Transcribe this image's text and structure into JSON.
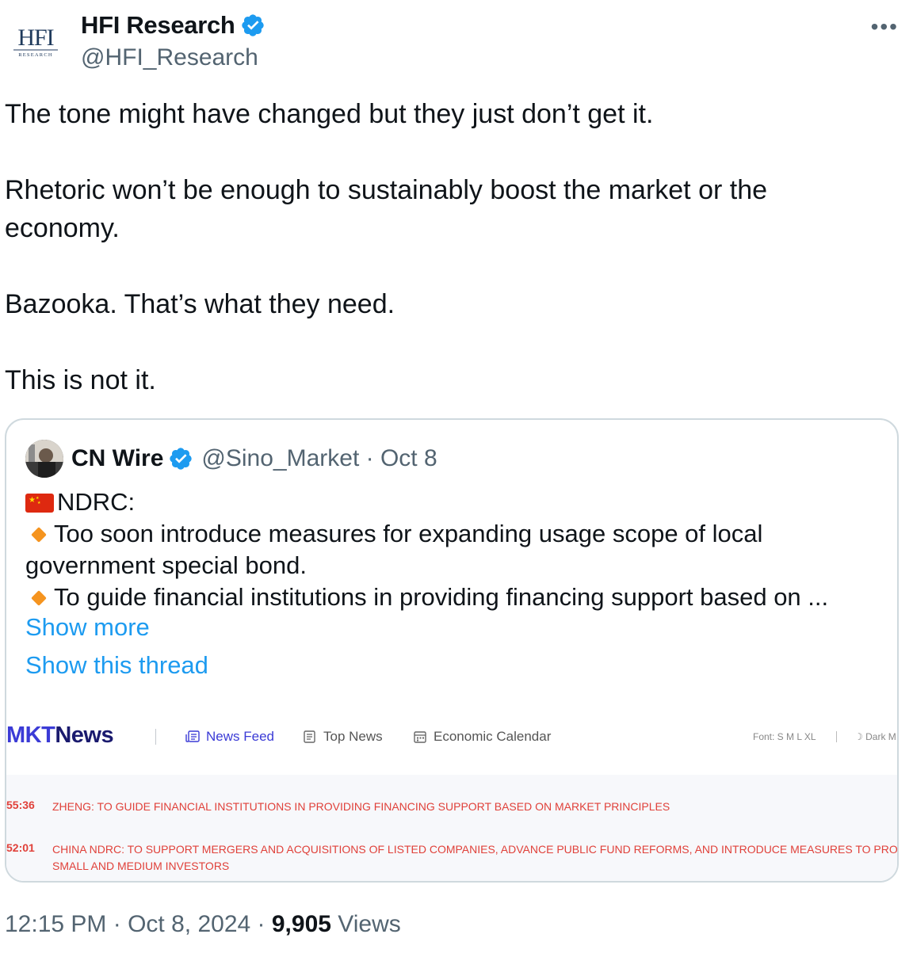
{
  "author": {
    "name": "HFI Research",
    "handle": "@HFI_Research",
    "avatar_text": "HFI",
    "avatar_subtext": "RESEARCH",
    "verified_color": "#1d9bf0"
  },
  "tweet": {
    "paragraphs": [
      "The tone might have changed but they just don’t get it.",
      "Rhetoric won’t be enough to sustainably boost the market or the economy.",
      "Bazooka. That’s what they need.",
      "This is not it."
    ]
  },
  "quote": {
    "name": "CN Wire",
    "handle": "@Sino_Market",
    "date": "Oct 8",
    "lines": [
      "NDRC:",
      "Too soon introduce measures for expanding usage scope of local government special bond.",
      "To guide financial institutions in providing financing support based on ..."
    ],
    "show_more": "Show more",
    "show_thread": "Show this thread",
    "embed": {
      "logo_part1": "MKT",
      "logo_part2": "News",
      "nav": [
        "News Feed",
        "Top News",
        "Economic Calendar"
      ],
      "font_label": "Font: S M L XL",
      "dark_label": "Dark M",
      "rows": [
        {
          "time": "55:36",
          "headline": "ZHENG: TO GUIDE FINANCIAL INSTITUTIONS IN PROVIDING FINANCING SUPPORT BASED ON MARKET PRINCIPLES"
        },
        {
          "time": "52:01",
          "headline": "CHINA NDRC: TO SUPPORT MERGERS AND ACQUISITIONS OF LISTED COMPANIES, ADVANCE PUBLIC FUND REFORMS, AND INTRODUCE MEASURES TO PROTECT",
          "headline_cont": "SMALL AND MEDIUM INVESTORS"
        }
      ],
      "accent_color": "#3b3bd6",
      "headline_color": "#e0413a"
    }
  },
  "footer": {
    "time": "12:15 PM",
    "date": "Oct 8, 2024",
    "views_count": "9,905",
    "views_label": "Views"
  },
  "icons": [
    "verified-icon",
    "more-icon",
    "flag-cn-icon",
    "diamond-icon",
    "news-feed-icon",
    "top-news-icon",
    "calendar-icon",
    "moon-icon"
  ]
}
